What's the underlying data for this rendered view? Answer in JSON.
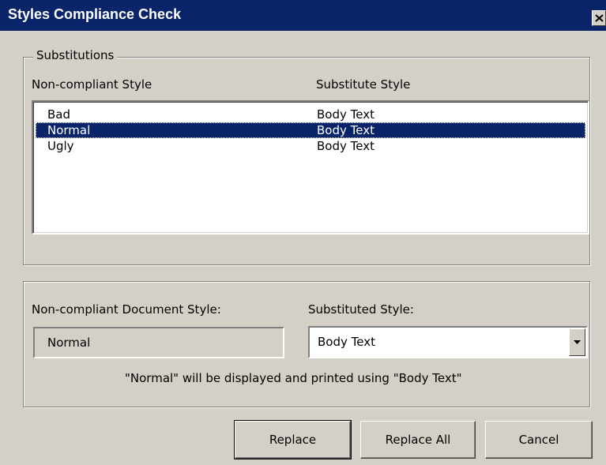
{
  "window": {
    "title": "Styles Compliance Check",
    "close_icon": "close-icon"
  },
  "substitutions": {
    "group_label": "Substitutions",
    "column_headers": [
      "Non-compliant Style",
      "Substitute Style"
    ],
    "rows": [
      {
        "style": "Bad",
        "substitute": "Body Text",
        "selected": false
      },
      {
        "style": "Normal",
        "substitute": "Body Text",
        "selected": true
      },
      {
        "style": "Ugly",
        "substitute": "Body Text",
        "selected": false
      }
    ]
  },
  "detail": {
    "document_style_label": "Non-compliant Document Style:",
    "document_style_value": "Normal",
    "substituted_style_label": "Substituted Style:",
    "substituted_style_value": "Body Text",
    "message": "\"Normal\" will be displayed and printed using \"Body Text\""
  },
  "buttons": {
    "replace": "Replace",
    "replace_all": "Replace All",
    "cancel": "Cancel"
  },
  "colors": {
    "titlebar": "#0a246a",
    "selection": "#0a246a",
    "face": "#d4d0c8"
  }
}
